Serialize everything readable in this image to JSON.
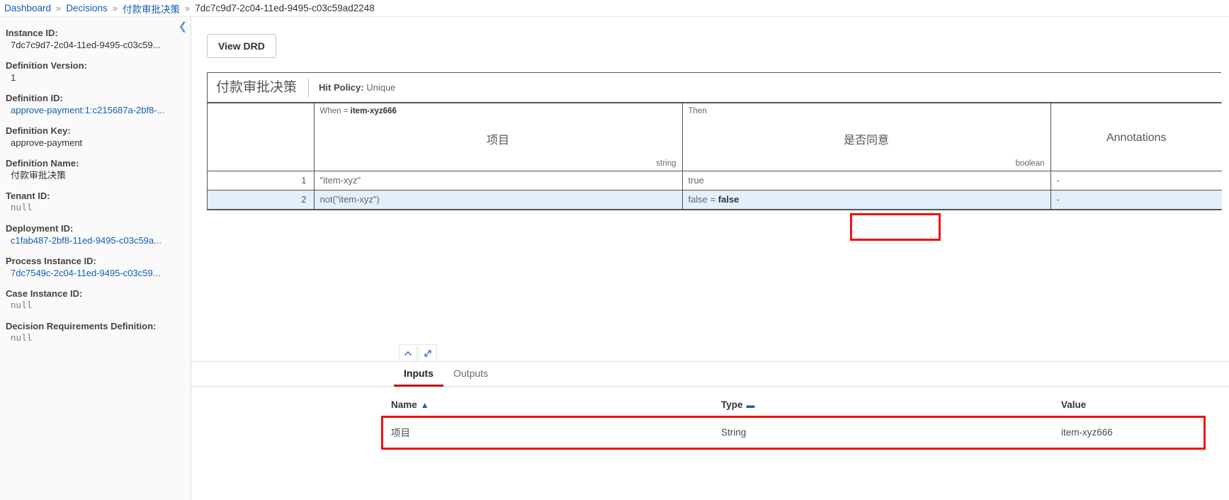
{
  "breadcrumb": {
    "items": [
      {
        "label": "Dashboard",
        "link": true
      },
      {
        "label": "Decisions",
        "link": true
      },
      {
        "label": "付款审批决策",
        "link": true
      },
      {
        "label": "7dc7c9d7-2c04-11ed-9495-c03c59ad2248",
        "link": false
      }
    ],
    "separator": "»"
  },
  "sidebar": {
    "collapse_icon": "chevron-left-icon",
    "properties": [
      {
        "label": "Instance ID:",
        "value": "7dc7c9d7-2c04-11ed-9495-c03c59...",
        "style": "plain"
      },
      {
        "label": "Definition Version:",
        "value": "1",
        "style": "plain"
      },
      {
        "label": "Definition ID:",
        "value": "approve-payment:1:c215687a-2bf8-...",
        "style": "link"
      },
      {
        "label": "Definition Key:",
        "value": "approve-payment",
        "style": "plain"
      },
      {
        "label": "Definition Name:",
        "value": "付款审批决策",
        "style": "plain"
      },
      {
        "label": "Tenant ID:",
        "value": "null",
        "style": "mono"
      },
      {
        "label": "Deployment ID:",
        "value": "c1fab487-2bf8-11ed-9495-c03c59a...",
        "style": "link"
      },
      {
        "label": "Process Instance ID:",
        "value": "7dc7549c-2c04-11ed-9495-c03c59...",
        "style": "link"
      },
      {
        "label": "Case Instance ID:",
        "value": "null",
        "style": "mono"
      },
      {
        "label": "Decision Requirements Definition:",
        "value": "null",
        "style": "mono"
      }
    ]
  },
  "main": {
    "view_drd_label": "View DRD",
    "decision_table": {
      "title": "付款审批决策",
      "hit_policy_label": "Hit Policy:",
      "hit_policy_value": "Unique",
      "columns": [
        {
          "kind_label": "",
          "kind_value": "",
          "name": "",
          "type": "",
          "key": "index"
        },
        {
          "kind_label": "When =",
          "kind_value": "item-xyz666",
          "name": "项目",
          "type": "string",
          "key": "when"
        },
        {
          "kind_label": "Then",
          "kind_value": "",
          "name": "是否同意",
          "type": "boolean",
          "key": "then"
        },
        {
          "kind_label": "",
          "kind_value": "",
          "name": "Annotations",
          "type": "",
          "key": "annotations"
        }
      ],
      "rows": [
        {
          "index": "1",
          "when": "\"item-xyz\"",
          "then": "true",
          "then_bold": "",
          "annotations": "-",
          "highlight": false
        },
        {
          "index": "2",
          "when": "not(\"item-xyz\")",
          "then": "false = ",
          "then_bold": "false",
          "annotations": "-",
          "highlight": true
        }
      ]
    },
    "panel": {
      "collapse_icon": "chevron-up-icon",
      "expand_icon": "expand-diagonal-icon",
      "tabs": [
        {
          "label": "Inputs",
          "active": true
        },
        {
          "label": "Outputs",
          "active": false
        }
      ],
      "io_table": {
        "headers": [
          {
            "label": "Name",
            "sort": "▲"
          },
          {
            "label": "Type",
            "sort": "▬"
          },
          {
            "label": "Value",
            "sort": ""
          }
        ],
        "rows": [
          {
            "name": "项目",
            "type": "String",
            "value": "item-xyz666"
          }
        ]
      }
    }
  },
  "highlight_color": "#f40f0f"
}
